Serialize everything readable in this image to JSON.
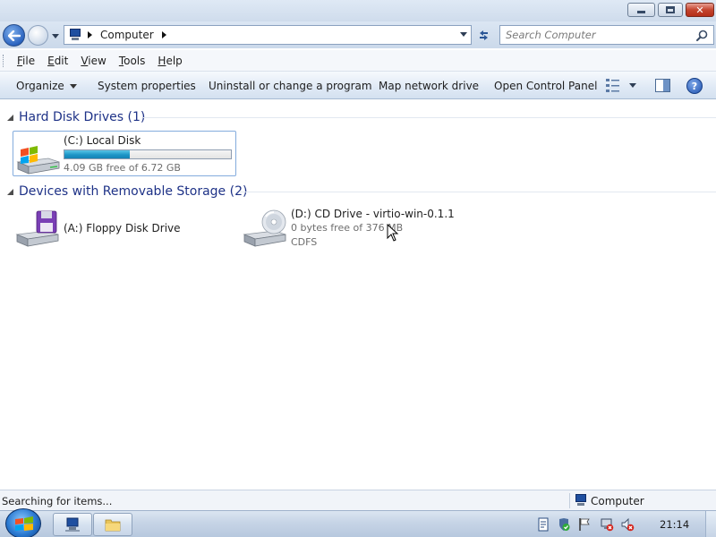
{
  "window": {
    "controls": {
      "minimize_icon": "minimize-icon",
      "maximize_icon": "restore-icon",
      "close_icon": "close-icon",
      "close_glyph": "✕"
    }
  },
  "navigation": {
    "address_path": "Computer",
    "search_placeholder": "Search Computer",
    "back_icon": "back-arrow-icon",
    "forward_icon": "forward-arrow-icon",
    "refresh_icon": "refresh-icon"
  },
  "menu": {
    "items": [
      {
        "label": "File",
        "underline": "F"
      },
      {
        "label": "Edit",
        "underline": "E"
      },
      {
        "label": "View",
        "underline": "V"
      },
      {
        "label": "Tools",
        "underline": "T"
      },
      {
        "label": "Help",
        "underline": "H"
      }
    ]
  },
  "command_bar": {
    "organize": "Organize",
    "system_properties": "System properties",
    "uninstall": "Uninstall or change a program",
    "map_drive": "Map network drive",
    "control_panel": "Open Control Panel",
    "help_glyph": "?"
  },
  "groups": {
    "hard_disks": {
      "title": "Hard Disk Drives (1)",
      "drives": [
        {
          "name": "(C:) Local Disk",
          "free_text": "4.09 GB free of 6.72 GB",
          "used_fraction": 0.391,
          "icon": "windows-drive-icon"
        }
      ]
    },
    "removable": {
      "title": "Devices with Removable Storage (2)",
      "drives": [
        {
          "name": "(A:) Floppy Disk Drive",
          "icon": "floppy-drive-icon"
        },
        {
          "name": "(D:) CD Drive - virtio-win-0.1.1",
          "free_text": "0 bytes free of 376 MB",
          "filesystem": "CDFS",
          "icon": "cd-drive-icon"
        }
      ]
    }
  },
  "status_bar": {
    "status": "Searching for items...",
    "location": "Computer"
  },
  "taskbar": {
    "clock": "21:14",
    "colors": {
      "accent": "#1e3287",
      "bar_fill": "#1d95c7"
    }
  }
}
